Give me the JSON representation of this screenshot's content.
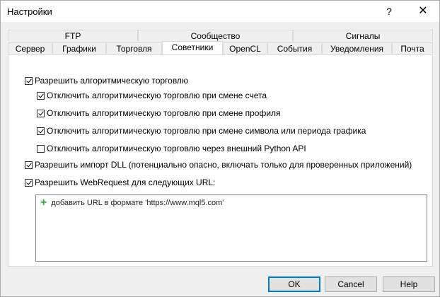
{
  "window": {
    "title": "Настройки",
    "help_glyph": "?",
    "close_glyph": "✕"
  },
  "tabs": {
    "row_top": [
      "FTP",
      "Сообщество",
      "Сигналы"
    ],
    "row_bottom": [
      "Сервер",
      "Графики",
      "Торговля",
      "Советники",
      "OpenCL",
      "События",
      "Уведомления",
      "Почта"
    ],
    "active": "Советники"
  },
  "options": [
    {
      "label": "Разрешить алгоритмическую торговлю",
      "checked": true
    },
    {
      "label": "Отключить алгоритмическую торговлю при смене счета",
      "checked": true
    },
    {
      "label": "Отключить алгоритмическую торговлю при смене профиля",
      "checked": true
    },
    {
      "label": "Отключить алгоритмическую торговлю при смене символа или периода графика",
      "checked": true
    },
    {
      "label": "Отключить алгоритмическую торговлю через внешний Python API",
      "checked": false
    },
    {
      "label": "Разрешить импорт DLL (потенциально опасно, включать только для проверенных приложений)",
      "checked": true
    },
    {
      "label": "Разрешить WebRequest для следующих URL:",
      "checked": true
    }
  ],
  "url_list": {
    "add_label": "добавить URL в формате 'https://www.mql5.com'",
    "add_icon": "plus-icon"
  },
  "buttons": {
    "ok": "OK",
    "cancel": "Cancel",
    "help": "Help"
  },
  "colors": {
    "accent": "#0078d7",
    "plus": "#2fa82f"
  }
}
